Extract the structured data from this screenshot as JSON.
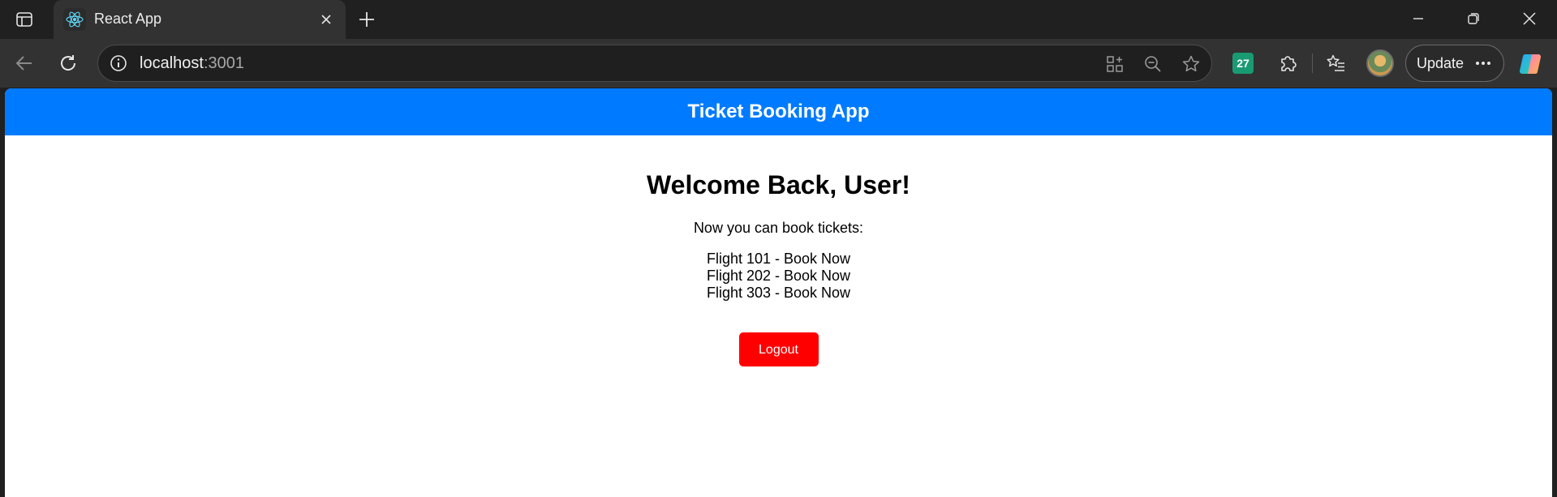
{
  "browser": {
    "tab": {
      "title": "React App"
    },
    "address": {
      "host": "localhost",
      "port": ":3001"
    },
    "extension_badge": "27",
    "update_label": "Update",
    "icons": {
      "tab_actions": "tab-actions-icon",
      "tab_favicon": "react-icon",
      "tab_close": "close-icon",
      "new_tab": "plus-icon",
      "minimize": "minimize-icon",
      "restore": "restore-icon",
      "close_window": "close-window-icon",
      "back": "back-arrow-icon",
      "refresh": "refresh-icon",
      "site_info": "info-icon",
      "app_available": "app-available-icon",
      "zoom": "zoom-out-icon",
      "favorite": "star-icon",
      "extensions": "puzzle-icon",
      "favorites": "favorites-icon",
      "more": "ellipsis-icon",
      "copilot": "copilot-icon"
    }
  },
  "app": {
    "header_title": "Ticket Booking App",
    "welcome": "Welcome Back, User!",
    "subtitle": "Now you can book tickets:",
    "flights": [
      "Flight 101 - Book Now",
      "Flight 202 - Book Now",
      "Flight 303 - Book Now"
    ],
    "logout_label": "Logout"
  },
  "colors": {
    "header_bg": "#007bff",
    "logout_bg": "#ff0000",
    "browser_chrome": "#202020",
    "toolbar": "#323232"
  }
}
